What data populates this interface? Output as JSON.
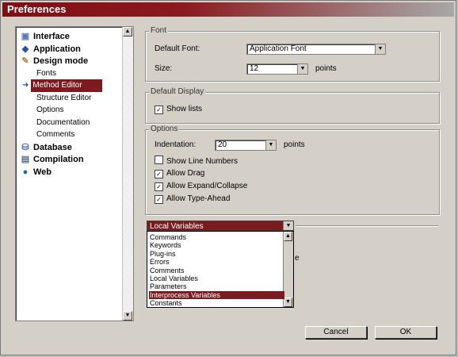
{
  "window": {
    "title": "Preferences"
  },
  "tree": {
    "items": [
      {
        "label": "Interface",
        "icon": "interface-icon",
        "level": 0
      },
      {
        "label": "Application",
        "icon": "application-icon",
        "level": 0
      },
      {
        "label": "Design mode",
        "icon": "design-mode-icon",
        "level": 0
      },
      {
        "label": "Fonts",
        "level": 1
      },
      {
        "label": "Method Editor",
        "level": 1,
        "selected": true
      },
      {
        "label": "Structure Editor",
        "level": 1
      },
      {
        "label": "Options",
        "level": 1
      },
      {
        "label": "Documentation",
        "level": 1
      },
      {
        "label": "Comments",
        "level": 1
      },
      {
        "label": "Database",
        "icon": "database-icon",
        "level": 0
      },
      {
        "label": "Compilation",
        "icon": "compilation-icon",
        "level": 0
      },
      {
        "label": "Web",
        "icon": "web-icon",
        "level": 0
      }
    ]
  },
  "font_group": {
    "title": "Font",
    "default_font_label": "Default Font:",
    "default_font_value": "Application Font",
    "size_label": "Size:",
    "size_value": "12",
    "size_unit": "points"
  },
  "display_group": {
    "title": "Default Display",
    "show_lists": {
      "label": "Show lists",
      "checked": true
    }
  },
  "options_group": {
    "title": "Options",
    "indentation_label": "Indentation:",
    "indentation_value": "20",
    "indentation_unit": "points",
    "checkboxes": [
      {
        "label": "Show Line Numbers",
        "checked": false
      },
      {
        "label": "Allow Drag",
        "checked": true
      },
      {
        "label": "Allow Expand/Collapse",
        "checked": true
      },
      {
        "label": "Allow Type-Ahead",
        "checked": true
      }
    ]
  },
  "color_dropdown": {
    "selected": "Local Variables",
    "options": [
      "Commands",
      "Keywords",
      "Plug-ins",
      "Errors",
      "Comments",
      "Local Variables",
      "Parameters",
      "Interprocess Variables",
      "Constants"
    ],
    "highlighted": "Interprocess Variables",
    "partial_text": "e"
  },
  "buttons": {
    "cancel": "Cancel",
    "ok": "OK"
  },
  "colors": {
    "accent": "#7b1a1f",
    "title_gradient_start": "#7f0f14"
  }
}
